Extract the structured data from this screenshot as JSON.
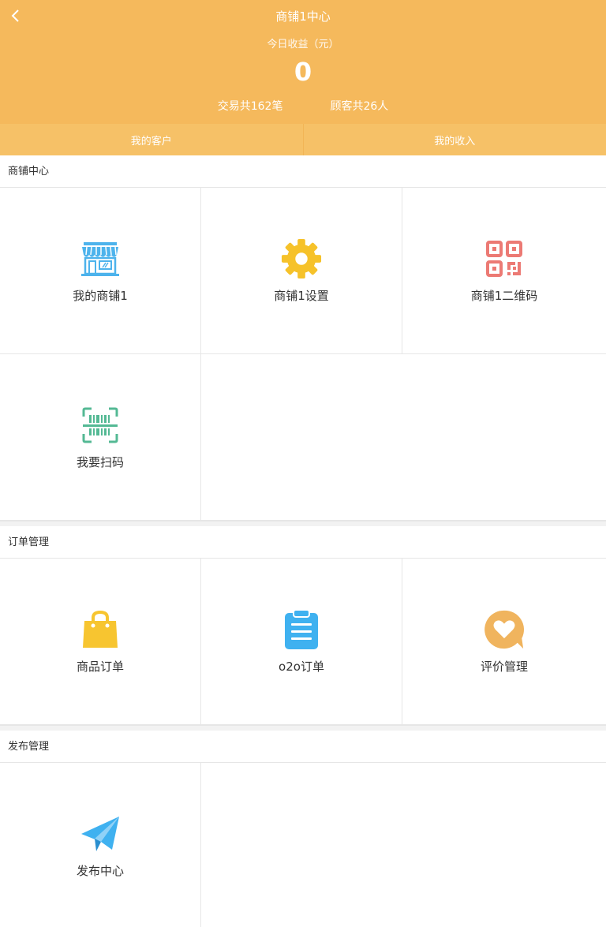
{
  "header": {
    "title": "商铺1中心",
    "income_label": "今日收益（元）",
    "income_value": "0",
    "transactions": "交易共162笔",
    "customers": "顾客共26人"
  },
  "tabs": [
    "我的客户",
    "我的收入"
  ],
  "sections": [
    {
      "title": "商铺中心",
      "items": [
        {
          "label": "我的商铺1",
          "icon": "shop-icon"
        },
        {
          "label": "商铺1设置",
          "icon": "gear-icon"
        },
        {
          "label": "商铺1二维码",
          "icon": "qr-code-icon"
        },
        {
          "label": "我要扫码",
          "icon": "scan-icon"
        }
      ]
    },
    {
      "title": "订单管理",
      "items": [
        {
          "label": "商品订单",
          "icon": "shopping-bag-icon"
        },
        {
          "label": "o2o订单",
          "icon": "clipboard-icon"
        },
        {
          "label": "评价管理",
          "icon": "heart-chat-icon"
        }
      ]
    },
    {
      "title": "发布管理",
      "items": [
        {
          "label": "发布中心",
          "icon": "paper-plane-icon"
        }
      ]
    }
  ],
  "colors": {
    "header": "#f5b95c",
    "tabs": "#f6c167",
    "shop": "#4db3ec",
    "gear": "#f6c22a",
    "qr": "#ec7a74",
    "scan": "#54b994",
    "bag": "#f7c530",
    "clipboard": "#3fb1f0",
    "heart_chat": "#f0b45e",
    "plane": "#3fb1f0"
  }
}
